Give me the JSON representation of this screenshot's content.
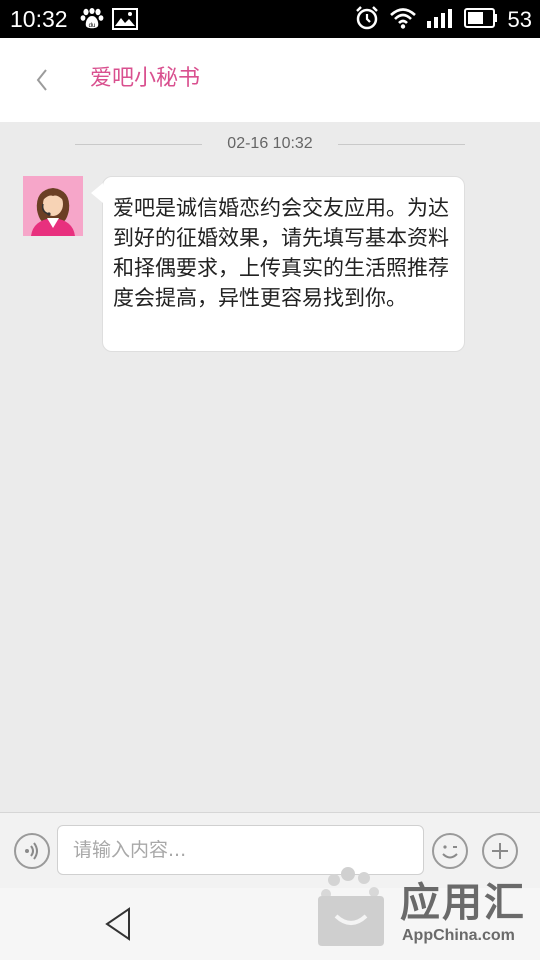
{
  "status_bar": {
    "time": "10:32",
    "battery": "53",
    "left_icons": [
      "baidu-icon",
      "image-icon"
    ],
    "right_icons": [
      "alarm-icon",
      "wifi-icon",
      "signal-icon",
      "battery-icon"
    ]
  },
  "header": {
    "title": "爱吧小秘书",
    "title_color": "#d9508f"
  },
  "chat": {
    "timestamp": "02-16 10:32",
    "messages": [
      {
        "sender": "爱吧小秘书",
        "text": "爱吧是诚信婚恋约会交友应用。为达到好的征婚效果，请先填写基本资料和择偶要求，上传真实的生活照推荐度会提高，异性更容易找到你。"
      }
    ]
  },
  "input_bar": {
    "placeholder": "请输入内容...",
    "value": ""
  },
  "watermark": {
    "text": "应用汇",
    "sub": "AppChina.com"
  }
}
